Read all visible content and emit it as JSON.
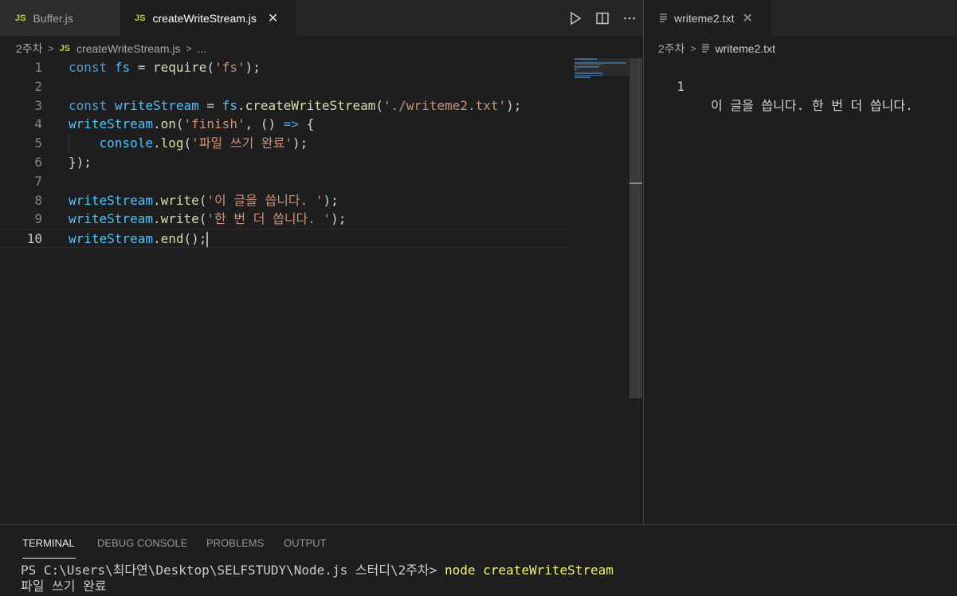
{
  "left_group": {
    "tabs": [
      {
        "icon": "JS",
        "label": "Buffer.js"
      },
      {
        "icon": "JS",
        "label": "createWriteStream.js",
        "close": "✕"
      }
    ],
    "breadcrumb": {
      "folder": "2주차",
      "file_icon": "JS",
      "file": "createWriteStream.js",
      "more": "..."
    }
  },
  "code_lines": [
    {
      "num": "1",
      "tokens": [
        [
          "kw",
          "const"
        ],
        [
          "plain",
          " "
        ],
        [
          "var",
          "fs"
        ],
        [
          "plain",
          " = "
        ],
        [
          "fn",
          "require"
        ],
        [
          "plain",
          "("
        ],
        [
          "str",
          "'fs'"
        ],
        [
          "plain",
          ");"
        ]
      ]
    },
    {
      "num": "2",
      "tokens": []
    },
    {
      "num": "3",
      "tokens": [
        [
          "kw",
          "const"
        ],
        [
          "plain",
          " "
        ],
        [
          "var",
          "writeStream"
        ],
        [
          "plain",
          " = "
        ],
        [
          "var",
          "fs"
        ],
        [
          "plain",
          "."
        ],
        [
          "fn",
          "createWriteStream"
        ],
        [
          "plain",
          "("
        ],
        [
          "str",
          "'./writeme2.txt'"
        ],
        [
          "plain",
          ");"
        ]
      ]
    },
    {
      "num": "4",
      "tokens": [
        [
          "var",
          "writeStream"
        ],
        [
          "plain",
          "."
        ],
        [
          "fn",
          "on"
        ],
        [
          "plain",
          "("
        ],
        [
          "str",
          "'finish'"
        ],
        [
          "plain",
          ", () "
        ],
        [
          "kw",
          "=>"
        ],
        [
          "plain",
          " {"
        ]
      ]
    },
    {
      "num": "5",
      "tokens": [
        [
          "plain",
          "    "
        ],
        [
          "var",
          "console"
        ],
        [
          "plain",
          "."
        ],
        [
          "fn",
          "log"
        ],
        [
          "plain",
          "("
        ],
        [
          "str",
          "'파일 쓰기 완료'"
        ],
        [
          "plain",
          ");"
        ]
      ]
    },
    {
      "num": "6",
      "tokens": [
        [
          "plain",
          "});"
        ]
      ]
    },
    {
      "num": "7",
      "tokens": []
    },
    {
      "num": "8",
      "tokens": [
        [
          "var",
          "writeStream"
        ],
        [
          "plain",
          "."
        ],
        [
          "fn",
          "write"
        ],
        [
          "plain",
          "("
        ],
        [
          "str",
          "'이 글을 씁니다. '"
        ],
        [
          "plain",
          ");"
        ]
      ]
    },
    {
      "num": "9",
      "tokens": [
        [
          "var",
          "writeStream"
        ],
        [
          "plain",
          "."
        ],
        [
          "fn",
          "write"
        ],
        [
          "plain",
          "("
        ],
        [
          "str",
          "'한 번 더 씁니다. '"
        ],
        [
          "plain",
          ");"
        ]
      ]
    },
    {
      "num": "10",
      "tokens": [
        [
          "var",
          "writeStream"
        ],
        [
          "plain",
          "."
        ],
        [
          "fn",
          "end"
        ],
        [
          "plain",
          "();"
        ]
      ]
    }
  ],
  "right_group": {
    "tab": {
      "label": "writeme2.txt",
      "close": "✕"
    },
    "breadcrumb": {
      "folder": "2주차",
      "file": "writeme2.txt"
    },
    "lines": [
      {
        "num": "1",
        "text": "이 글을 씁니다. 한 번 더 씁니다."
      }
    ]
  },
  "panel": {
    "tabs": [
      "TERMINAL",
      "DEBUG CONSOLE",
      "PROBLEMS",
      "OUTPUT"
    ],
    "terminal": {
      "prompt": "PS C:\\Users\\최다연\\Desktop\\SELFSTUDY\\Node.js 스터디\\2주차> ",
      "command": "node createWriteStream",
      "output": "파일 쓰기 완료"
    }
  },
  "colors": {
    "keyword": "#569cd6",
    "variable": "#4fc1ff",
    "function": "#dcdcaa",
    "string": "#ce9178",
    "js_icon": "#cbcb41"
  }
}
